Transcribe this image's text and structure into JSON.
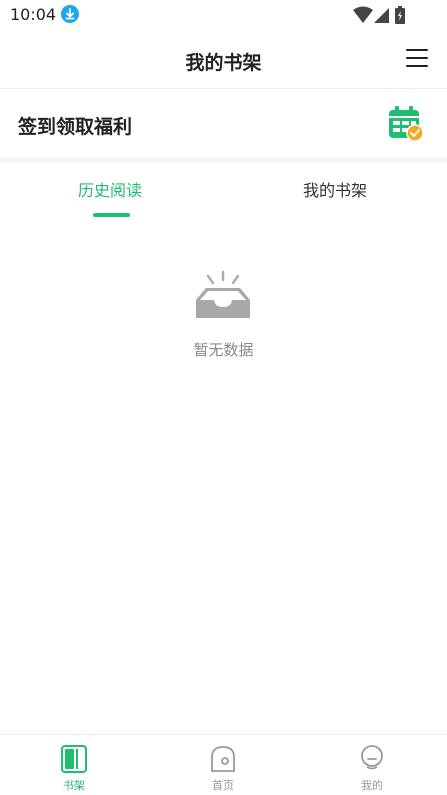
{
  "status_bar": {
    "time": "10:04",
    "icons": [
      "download-icon",
      "wifi-icon",
      "signal-icon",
      "battery-charging-icon"
    ]
  },
  "header": {
    "title": "我的书架",
    "menu_icon": "menu-icon"
  },
  "signin": {
    "label": "签到领取福利",
    "icon": "calendar-check-icon"
  },
  "tabs": [
    {
      "label": "历史阅读",
      "active": true
    },
    {
      "label": "我的书架",
      "active": false
    }
  ],
  "empty_state": {
    "icon": "empty-inbox-icon",
    "text": "暂无数据"
  },
  "bottom_nav": [
    {
      "label": "书架",
      "icon": "bookshelf-icon",
      "active": true
    },
    {
      "label": "首页",
      "icon": "home-icon",
      "active": false
    },
    {
      "label": "我的",
      "icon": "profile-icon",
      "active": false
    }
  ],
  "colors": {
    "accent": "#1fbd6f",
    "calendar_check": "#f5a623",
    "download_badge": "#1ea6f0"
  }
}
